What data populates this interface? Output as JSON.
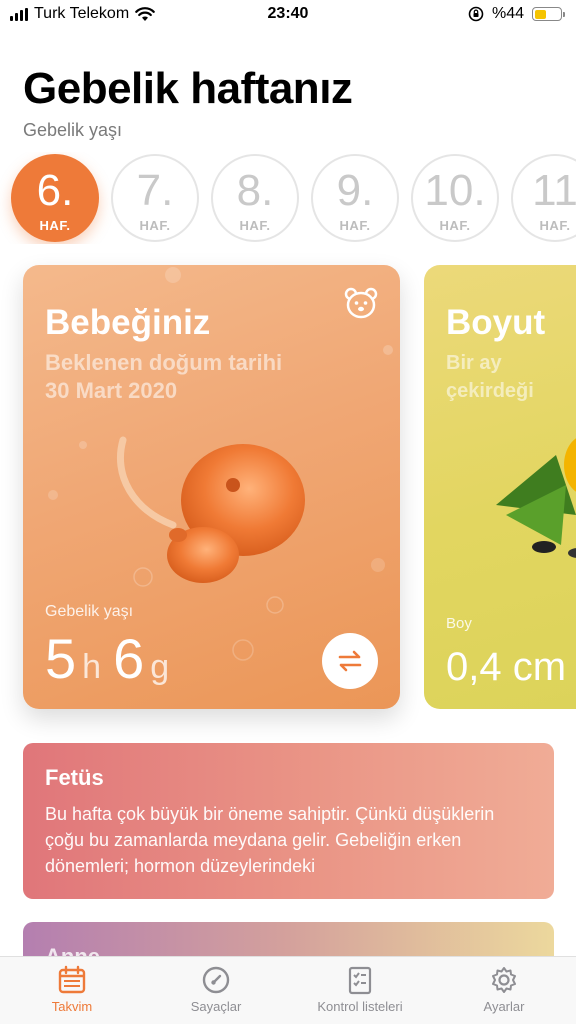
{
  "status_bar": {
    "carrier": "Turk Telekom",
    "time": "23:40",
    "battery_text": "%44",
    "battery_level": 0.44,
    "icons": [
      "signal-icon",
      "wifi-icon",
      "orientation-lock-icon",
      "battery-icon"
    ]
  },
  "header": {
    "title": "Gebelik haftanız",
    "subtitle": "Gebelik yaşı"
  },
  "weeks": [
    {
      "num": "6.",
      "unit": "HAF.",
      "active": true
    },
    {
      "num": "7.",
      "unit": "HAF.",
      "active": false
    },
    {
      "num": "8.",
      "unit": "HAF.",
      "active": false
    },
    {
      "num": "9.",
      "unit": "HAF.",
      "active": false
    },
    {
      "num": "10.",
      "unit": "HAF.",
      "active": false
    },
    {
      "num": "11",
      "unit": "HAF.",
      "active": false
    }
  ],
  "baby_card": {
    "title": "Bebeğiniz",
    "due_label": "Beklenen doğum tarihi",
    "due_date": "30 Mart 2020",
    "age_label": "Gebelik yaşı",
    "weeks_value": "5",
    "weeks_unit": "h",
    "days_value": "6",
    "days_unit": "g",
    "colors": {
      "accent": "#ee7a39"
    }
  },
  "size_card": {
    "title": "Boyut",
    "subtitle": "Bir ay çekirdeği",
    "length_label": "Boy",
    "length_value": "0,4 cm"
  },
  "info_card": {
    "title": "Fetüs",
    "body": "Bu hafta çok büyük bir öneme sahiptir. Çünkü düşüklerin çoğu bu zamanlarda meydana gelir. Gebeliğin erken dönemleri; hormon düzeylerindeki"
  },
  "info_card2": {
    "title": "Anne"
  },
  "tabs": [
    {
      "label": "Takvim",
      "icon": "calendar-icon",
      "active": true
    },
    {
      "label": "Sayaçlar",
      "icon": "compass-icon",
      "active": false
    },
    {
      "label": "Kontrol listeleri",
      "icon": "checklist-icon",
      "active": false
    },
    {
      "label": "Ayarlar",
      "icon": "gear-icon",
      "active": false
    }
  ]
}
